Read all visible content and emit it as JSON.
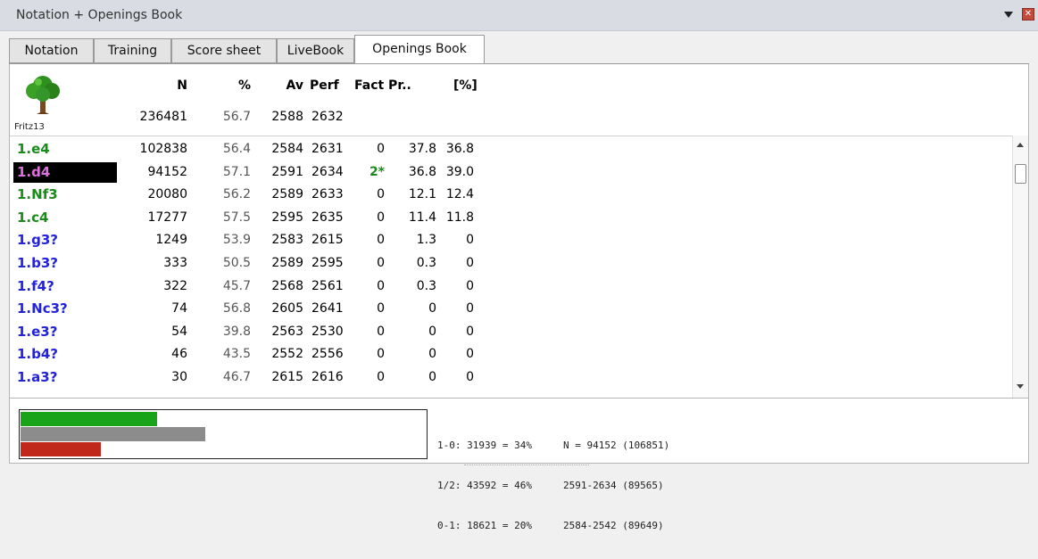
{
  "window": {
    "title": "Notation + Openings Book"
  },
  "tabs": [
    {
      "label": "Notation",
      "active": false
    },
    {
      "label": "Training",
      "active": false
    },
    {
      "label": "Score sheet",
      "active": false
    },
    {
      "label": "LiveBook",
      "active": false
    },
    {
      "label": "Openings Book",
      "active": true
    }
  ],
  "columns": {
    "n": "N",
    "pct": "%",
    "av": "Av",
    "perf": "Perf",
    "fact_pr": "Fact Pr..",
    "pct2": "[%]"
  },
  "book": {
    "name": "Fritz13",
    "icon": "tree-icon",
    "totals": {
      "n": "236481",
      "pct": "56.7",
      "av": "2588",
      "perf": "2632"
    }
  },
  "moves": [
    {
      "move": "1.e4",
      "n": "102838",
      "pct": "56.4",
      "av": "2584",
      "perf": "2631",
      "fact": "0",
      "pr": "37.8",
      "pct2": "36.8",
      "color": "#1a8a1a",
      "selected": false
    },
    {
      "move": "1.d4",
      "n": "94152",
      "pct": "57.1",
      "av": "2591",
      "perf": "2634",
      "fact": "2*",
      "pr": "36.8",
      "pct2": "39.0",
      "color": "#e070e0",
      "selected": true
    },
    {
      "move": "1.Nf3",
      "n": "20080",
      "pct": "56.2",
      "av": "2589",
      "perf": "2633",
      "fact": "0",
      "pr": "12.1",
      "pct2": "12.4",
      "color": "#1a8a1a",
      "selected": false
    },
    {
      "move": "1.c4",
      "n": "17277",
      "pct": "57.5",
      "av": "2595",
      "perf": "2635",
      "fact": "0",
      "pr": "11.4",
      "pct2": "11.8",
      "color": "#1a8a1a",
      "selected": false
    },
    {
      "move": "1.g3?",
      "n": "1249",
      "pct": "53.9",
      "av": "2583",
      "perf": "2615",
      "fact": "0",
      "pr": "1.3",
      "pct2": "0",
      "color": "#2222dd",
      "selected": false
    },
    {
      "move": "1.b3?",
      "n": "333",
      "pct": "50.5",
      "av": "2589",
      "perf": "2595",
      "fact": "0",
      "pr": "0.3",
      "pct2": "0",
      "color": "#2222dd",
      "selected": false
    },
    {
      "move": "1.f4?",
      "n": "322",
      "pct": "45.7",
      "av": "2568",
      "perf": "2561",
      "fact": "0",
      "pr": "0.3",
      "pct2": "0",
      "color": "#2222dd",
      "selected": false
    },
    {
      "move": "1.Nc3?",
      "n": "74",
      "pct": "56.8",
      "av": "2605",
      "perf": "2641",
      "fact": "0",
      "pr": "0",
      "pct2": "0",
      "color": "#2222dd",
      "selected": false
    },
    {
      "move": "1.e3?",
      "n": "54",
      "pct": "39.8",
      "av": "2563",
      "perf": "2530",
      "fact": "0",
      "pr": "0",
      "pct2": "0",
      "color": "#2222dd",
      "selected": false
    },
    {
      "move": "1.b4?",
      "n": "46",
      "pct": "43.5",
      "av": "2552",
      "perf": "2556",
      "fact": "0",
      "pr": "0",
      "pct2": "0",
      "color": "#2222dd",
      "selected": false
    },
    {
      "move": "1.a3?",
      "n": "30",
      "pct": "46.7",
      "av": "2615",
      "perf": "2616",
      "fact": "0",
      "pr": "0",
      "pct2": "0",
      "color": "#2222dd",
      "selected": false
    }
  ],
  "results": {
    "bars": [
      {
        "name": "white-wins-bar",
        "fraction": 0.34,
        "color": "#19a319"
      },
      {
        "name": "draws-bar",
        "fraction": 0.46,
        "color": "#8c8c8c"
      },
      {
        "name": "black-wins-bar",
        "fraction": 0.2,
        "color": "#c0281c"
      }
    ],
    "lines_left": [
      "1-0: 31939 = 34%",
      "1/2: 43592 = 46%",
      "0-1: 18621 = 20%"
    ],
    "lines_right": [
      "N = 94152 (106851)",
      "2591-2634 (89565)",
      "2584-2542 (89649)"
    ]
  },
  "colors": {
    "fact_highlight": "#1a8a1a"
  }
}
